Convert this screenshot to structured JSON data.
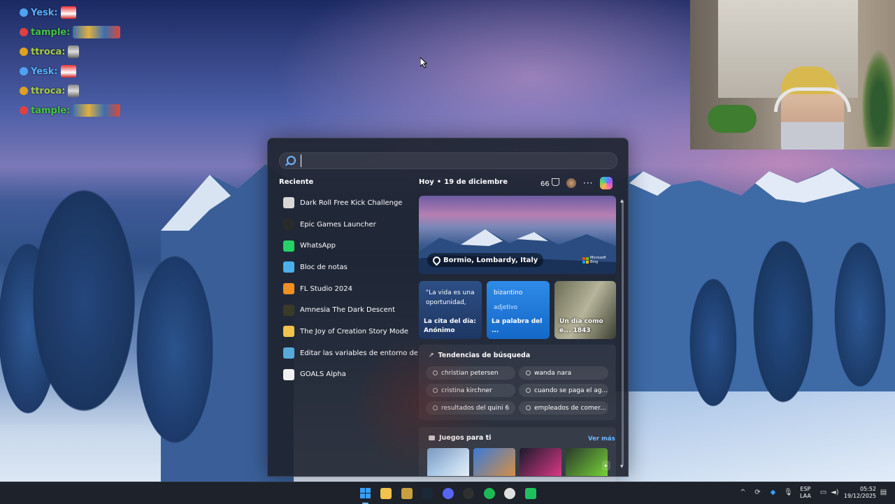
{
  "chat": [
    {
      "name": "Yesk:",
      "color": "#5ab0ff",
      "badge": "#4fa3f0",
      "emote": "santa"
    },
    {
      "name": "tample:",
      "color": "#46c646",
      "badge": "#e04040",
      "emote": "wide"
    },
    {
      "name": "ttroca:",
      "color": "#a8d048",
      "badge": "#e0a020",
      "emote": "gray"
    },
    {
      "name": "Yesk:",
      "color": "#5ab0ff",
      "badge": "#4fa3f0",
      "emote": "santa"
    },
    {
      "name": "ttroca:",
      "color": "#a8d048",
      "badge": "#e0a020",
      "emote": "gray"
    },
    {
      "name": "tample:",
      "color": "#46c646",
      "badge": "#e04040",
      "emote": "wide"
    }
  ],
  "start_menu": {
    "search": {
      "placeholder": "",
      "value": ""
    },
    "recent_title": "Reciente",
    "recent": [
      {
        "label": "Dark Roll Free Kick Challenge",
        "icon": "soccer-ball-icon",
        "color": "#d8d8d8"
      },
      {
        "label": "Epic Games Launcher",
        "icon": "epic-games-icon",
        "color": "#2a2a2a"
      },
      {
        "label": "WhatsApp",
        "icon": "whatsapp-icon",
        "color": "#25d366"
      },
      {
        "label": "Bloc de notas",
        "icon": "notepad-icon",
        "color": "#4ab0e8"
      },
      {
        "label": "FL Studio 2024",
        "icon": "fl-studio-icon",
        "color": "#f09020"
      },
      {
        "label": "Amnesia The Dark Descent",
        "icon": "amnesia-icon",
        "color": "#3a3a28"
      },
      {
        "label": "The Joy of Creation Story Mode",
        "icon": "folder-icon",
        "color": "#f2c14e"
      },
      {
        "label": "Editar las variables de entorno del sist...",
        "icon": "system-properties-icon",
        "color": "#58a8d8"
      },
      {
        "label": "GOALS Alpha",
        "icon": "goals-icon",
        "color": "#f2f2f2"
      }
    ],
    "feed": {
      "today_label": "Hoy",
      "date": "19 de diciembre",
      "points": "66",
      "hero": {
        "location": "Bormio, Lombardy, Italy",
        "brand_line1": "Microsoft",
        "brand_line2": "Bing"
      },
      "cards": [
        {
          "top": "\"La vida es una oportunidad,",
          "sub": "",
          "bottom": "La cita del día: Anónimo"
        },
        {
          "top": "bizantino",
          "sub": "adjetivo",
          "bottom": "La palabra del ..."
        },
        {
          "top": "",
          "sub": "",
          "bottom": "Un día como e... 1843"
        }
      ],
      "trends_title": "Tendencias de búsqueda",
      "trends": [
        "christian petersen",
        "wanda nara",
        "cristina kirchner",
        "cuando se paga el ag...",
        "resultados del quini 6",
        "empleados de comer..."
      ],
      "games_title": "Juegos para ti",
      "see_more": "Ver más",
      "games": [
        {
          "color1": "#7aa8d8",
          "color2": "#e8f0f8"
        },
        {
          "color1": "#3a7ad8",
          "color2": "#d89040"
        },
        {
          "color1": "#1a1a2a",
          "color2": "#e03a8a"
        },
        {
          "color1": "#2a3a2a",
          "color2": "#7ad83a"
        }
      ]
    }
  },
  "taskbar": {
    "icons": [
      {
        "name": "start-button",
        "icon": "windows-logo-icon"
      },
      {
        "name": "file-explorer-button",
        "icon": "folder-icon"
      },
      {
        "name": "app-button",
        "icon": "gallery-icon"
      },
      {
        "name": "steam-button",
        "icon": "steam-icon"
      },
      {
        "name": "discord-button",
        "icon": "discord-icon"
      },
      {
        "name": "obs-button",
        "icon": "obs-icon"
      },
      {
        "name": "spotify-button",
        "icon": "spotify-icon"
      },
      {
        "name": "chrome-button",
        "icon": "chrome-icon"
      },
      {
        "name": "app-green-button",
        "icon": "green-app-icon"
      }
    ],
    "lang_line1": "ESP",
    "lang_line2": "LAA",
    "time": "05:52",
    "date": "19/12/2025"
  }
}
